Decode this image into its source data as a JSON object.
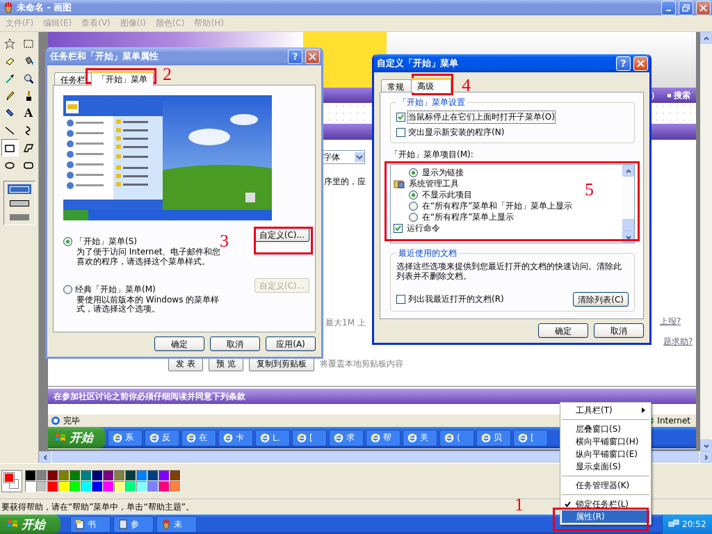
{
  "paint_window": {
    "title": "未命名 - 画图",
    "menu": [
      "文件(F)",
      "编辑(E)",
      "查看(V)",
      "图像(I)",
      "颜色(C)",
      "帮助(H)"
    ],
    "tools": [
      {
        "selected": false
      },
      {
        "selected": false
      },
      {
        "selected": false
      },
      {
        "selected": false
      },
      {
        "selected": false
      },
      {
        "selected": false
      },
      {
        "selected": false
      },
      {
        "selected": false
      },
      {
        "selected": false
      },
      {
        "selected": false,
        "glyph": "A"
      },
      {
        "selected": false
      },
      {
        "selected": false
      },
      {
        "selected": true
      },
      {
        "selected": false
      },
      {
        "selected": false
      },
      {
        "selected": false
      }
    ],
    "fill_styles": [
      {
        "selected": true
      },
      {
        "selected": false
      },
      {
        "selected": false
      }
    ],
    "palette": {
      "foreground": {
        "color": "#ff0000"
      },
      "background": {
        "color": "#ffffff"
      },
      "colors": [
        {
          "color": "#000000"
        },
        {
          "color": "#808080"
        },
        {
          "color": "#800000"
        },
        {
          "color": "#808000"
        },
        {
          "color": "#008000"
        },
        {
          "color": "#008080"
        },
        {
          "color": "#000080"
        },
        {
          "color": "#800080"
        },
        {
          "color": "#808040"
        },
        {
          "color": "#004040"
        },
        {
          "color": "#0080ff"
        },
        {
          "color": "#004080"
        },
        {
          "color": "#8000ff"
        },
        {
          "color": "#804000"
        },
        {
          "color": "#ffffff"
        },
        {
          "color": "#c0c0c0"
        },
        {
          "color": "#ff0000"
        },
        {
          "color": "#ffff00"
        },
        {
          "color": "#00ff00"
        },
        {
          "color": "#00ffff"
        },
        {
          "color": "#0000ff"
        },
        {
          "color": "#ff00ff"
        },
        {
          "color": "#ffff80"
        },
        {
          "color": "#00ff80"
        },
        {
          "color": "#80ffff"
        },
        {
          "color": "#8080ff"
        },
        {
          "color": "#ff0080"
        },
        {
          "color": "#ff8040"
        }
      ]
    },
    "status_bar": "要获得帮助，请在“帮助”菜单中，单击“帮助主题”。"
  },
  "web_page": {
    "nav_fragment": "）",
    "nav_link": "搜索",
    "font_select": "字体",
    "text_fragment": "序里的，应",
    "upload_note": "最大1M 上",
    "links": [
      "上报?",
      "题求助?"
    ],
    "buttons": [
      "发 表",
      "预 览",
      "复制到剪贴板"
    ],
    "clipboard_note": "将覆盖本地剪贴板内容",
    "terms_header": "在参加社区讨论之前你必须仔细阅读并同意下列条款",
    "browser_status": "完毕",
    "zone": "Internet",
    "taskbar": {
      "start": "开始",
      "tasks": [
        "系",
        "反",
        "在",
        "卡",
        "L.",
        "[",
        "求",
        "帮",
        "关",
        "(",
        "贝",
        "["
      ]
    }
  },
  "taskbar_dialog": {
    "title": "任务栏和「开始」菜单属性",
    "help": "?",
    "tabs": [
      {
        "label": "任务栏",
        "selected": false
      },
      {
        "label": "「开始」菜单",
        "selected": true
      }
    ],
    "options": [
      {
        "label": "「开始」菜单(S)",
        "description": "为了便于访问 Internet、电子邮件和您喜欢的程序，请选择这个菜单样式。",
        "selected": true,
        "button": "自定义(C)...",
        "button_disabled": false
      },
      {
        "label": "经典「开始」菜单(M)",
        "description": "要使用以前版本的 Windows 的菜单样式，请选择这个选项。",
        "selected": false,
        "button": "自定义(C)...",
        "button_disabled": true
      }
    ],
    "buttons": [
      "确定",
      "取消",
      "应用(A)"
    ]
  },
  "customize_dialog": {
    "title": "自定义「开始」菜单",
    "help": "?",
    "tabs": [
      {
        "label": "常规",
        "selected": false
      },
      {
        "label": "高级",
        "selected": true
      }
    ],
    "settings_group": {
      "title": "「开始」菜单设置",
      "options": [
        {
          "label": "当鼠标停止在它们上面时打开子菜单(O)",
          "checked": true,
          "focused": true
        },
        {
          "label": "突出显示新安装的程序(N)",
          "checked": false,
          "focused": false
        }
      ]
    },
    "items_label": "「开始」菜单项目(M):",
    "items": [
      {
        "kind": "radio",
        "label": "显示为链接",
        "selected": true
      },
      {
        "kind": "folder",
        "label": "系统管理工具",
        "children": [
          {
            "kind": "radio",
            "label": "不显示此项目",
            "selected": true
          },
          {
            "kind": "radio",
            "label": "在“所有程序”菜单和「开始」菜单上显示",
            "selected": false
          },
          {
            "kind": "radio",
            "label": "在“所有程序”菜单上显示",
            "selected": false
          }
        ]
      },
      {
        "kind": "checkbox",
        "label": "运行命令",
        "checked": true
      }
    ],
    "recent_group": {
      "title": "最近使用的文档",
      "description": "选择这些选项来提供到您最近打开的文档的快速访问。清除此列表并不删除文档。",
      "option": {
        "label": "列出我最近打开的文档(R)",
        "checked": false
      },
      "button": "清除列表(C)"
    },
    "buttons": [
      "确定",
      "取消"
    ]
  },
  "context_menu": {
    "items": [
      {
        "kind": "submenu",
        "label": "工具栏(T)",
        "selected": false
      },
      {
        "kind": "separator"
      },
      {
        "kind": "item",
        "label": "层叠窗口(S)",
        "selected": false
      },
      {
        "kind": "item",
        "label": "横向平铺窗口(H)",
        "selected": false
      },
      {
        "kind": "item",
        "label": "纵向平铺窗口(E)",
        "selected": false
      },
      {
        "kind": "item",
        "label": "显示桌面(S)",
        "selected": false
      },
      {
        "kind": "separator"
      },
      {
        "kind": "item",
        "label": "任务管理器(K)",
        "selected": false
      },
      {
        "kind": "separator"
      },
      {
        "kind": "check",
        "label": "锁定任务栏(L)",
        "checked": true,
        "selected": false
      },
      {
        "kind": "item",
        "label": "属性(R)",
        "selected": true
      }
    ]
  },
  "taskbar": {
    "start": "开始",
    "tasks": [
      {
        "label": "书"
      },
      {
        "label": "参"
      },
      {
        "label": "未"
      }
    ],
    "clock": "20:52"
  },
  "annotations": [
    {
      "label": "1"
    },
    {
      "label": "2"
    },
    {
      "label": "3"
    },
    {
      "label": "4"
    },
    {
      "label": "5"
    }
  ]
}
